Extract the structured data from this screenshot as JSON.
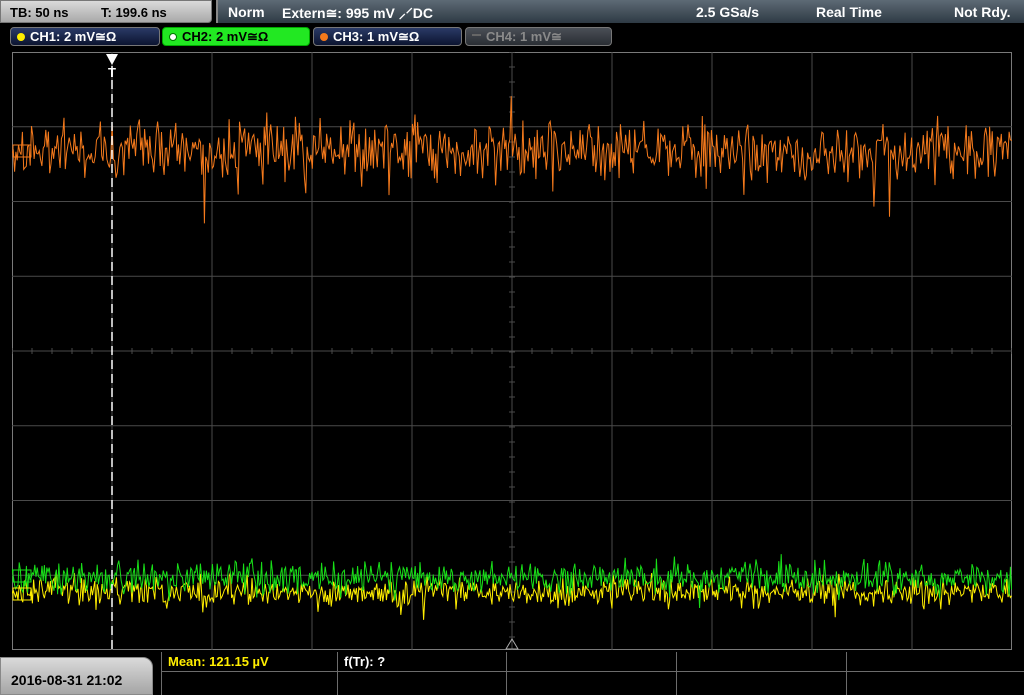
{
  "timebase": {
    "tb": "TB: 50 ns",
    "t": "T: 199.6 ns"
  },
  "status": {
    "mode": "Norm",
    "trigger": "Extern≅: 995 mV ⸝⸍DC",
    "sample_rate": "2.5 GSa/s",
    "acq": "Real Time",
    "state": "Not Rdy."
  },
  "channels": [
    {
      "label": "CH1: 2 mV≅Ω",
      "color": "#ffee00"
    },
    {
      "label": "CH2: 2 mV≅Ω",
      "color": "#18e018"
    },
    {
      "label": "CH3: 1 mV≅Ω",
      "color": "#f57a1c"
    },
    {
      "label": "CH4: 1 mV≅",
      "color": "#888888"
    }
  ],
  "trigger_marker": "T",
  "measurements": {
    "mean": "Mean: 121.15 µV",
    "freq": "f(Tr): ?"
  },
  "datetime": "2016-08-31 21:02",
  "colors": {
    "grid": "#4a4a4a",
    "ch1": "#ffee00",
    "ch2": "#18e018",
    "ch3": "#f57a1c"
  }
}
